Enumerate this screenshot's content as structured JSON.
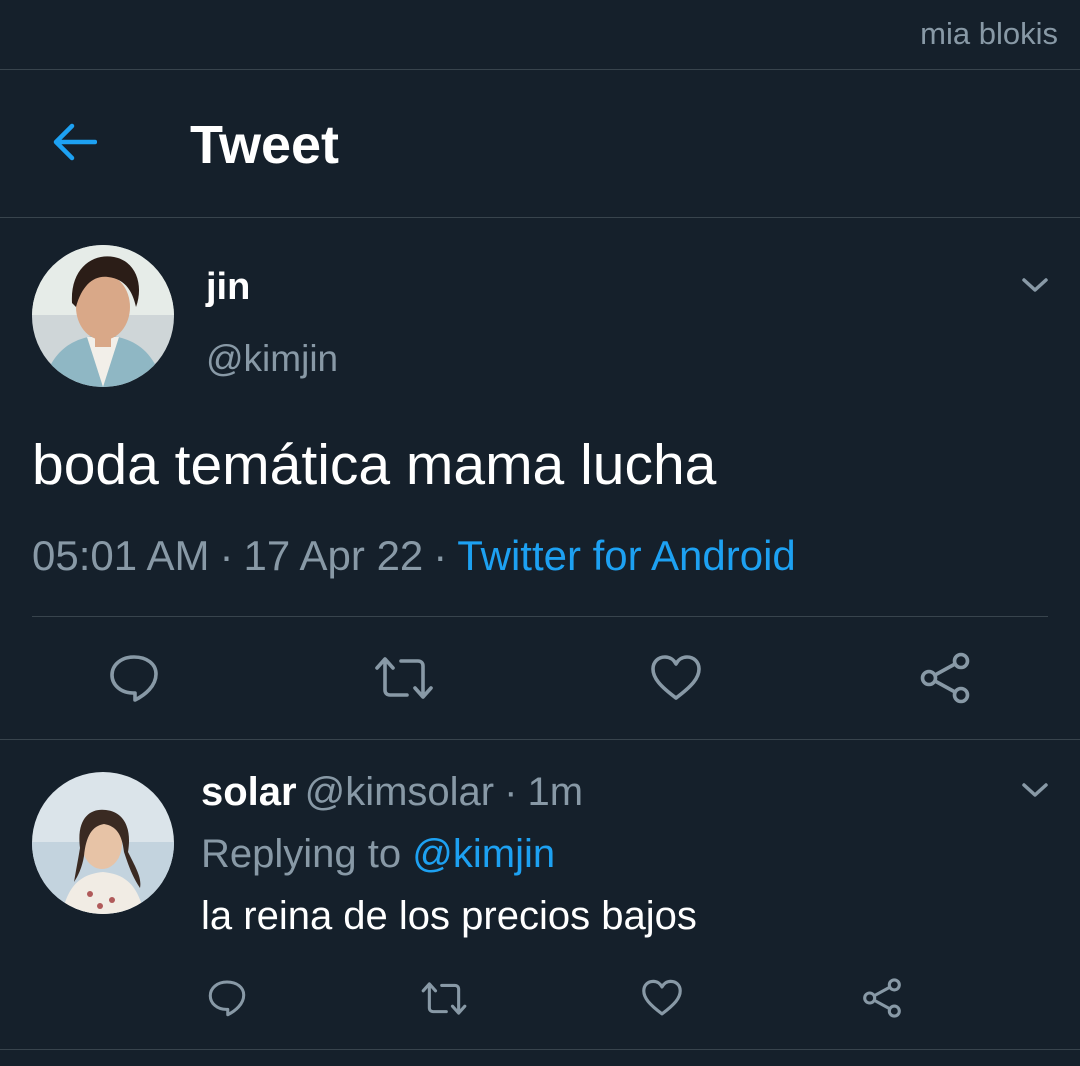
{
  "watermark": "mia blokis",
  "header": {
    "title": "Tweet",
    "back_icon": "arrow-left-icon",
    "accent": "#1da1f2"
  },
  "tweet": {
    "author_name": "jin",
    "author_handle": "@kimjin",
    "text": "boda temática mama lucha",
    "time": "05:01 AM",
    "sep1": "·",
    "date": "17 Apr 22",
    "sep2": "·",
    "source": "Twitter for Android",
    "actions": [
      "reply-icon",
      "retweet-icon",
      "like-icon",
      "share-icon"
    ]
  },
  "reply": {
    "author_name": "solar",
    "author_handle": "@kimsolar",
    "sep": "·",
    "time": "1m",
    "replying_prefix": "Replying to",
    "replying_to": "@kimjin",
    "text": "la reina de los precios bajos",
    "actions": [
      "reply-icon",
      "retweet-icon",
      "like-icon",
      "share-icon"
    ]
  },
  "colors": {
    "background": "#15202b",
    "divider": "#38444d",
    "secondary_text": "#8899a6",
    "link": "#1da1f2"
  }
}
